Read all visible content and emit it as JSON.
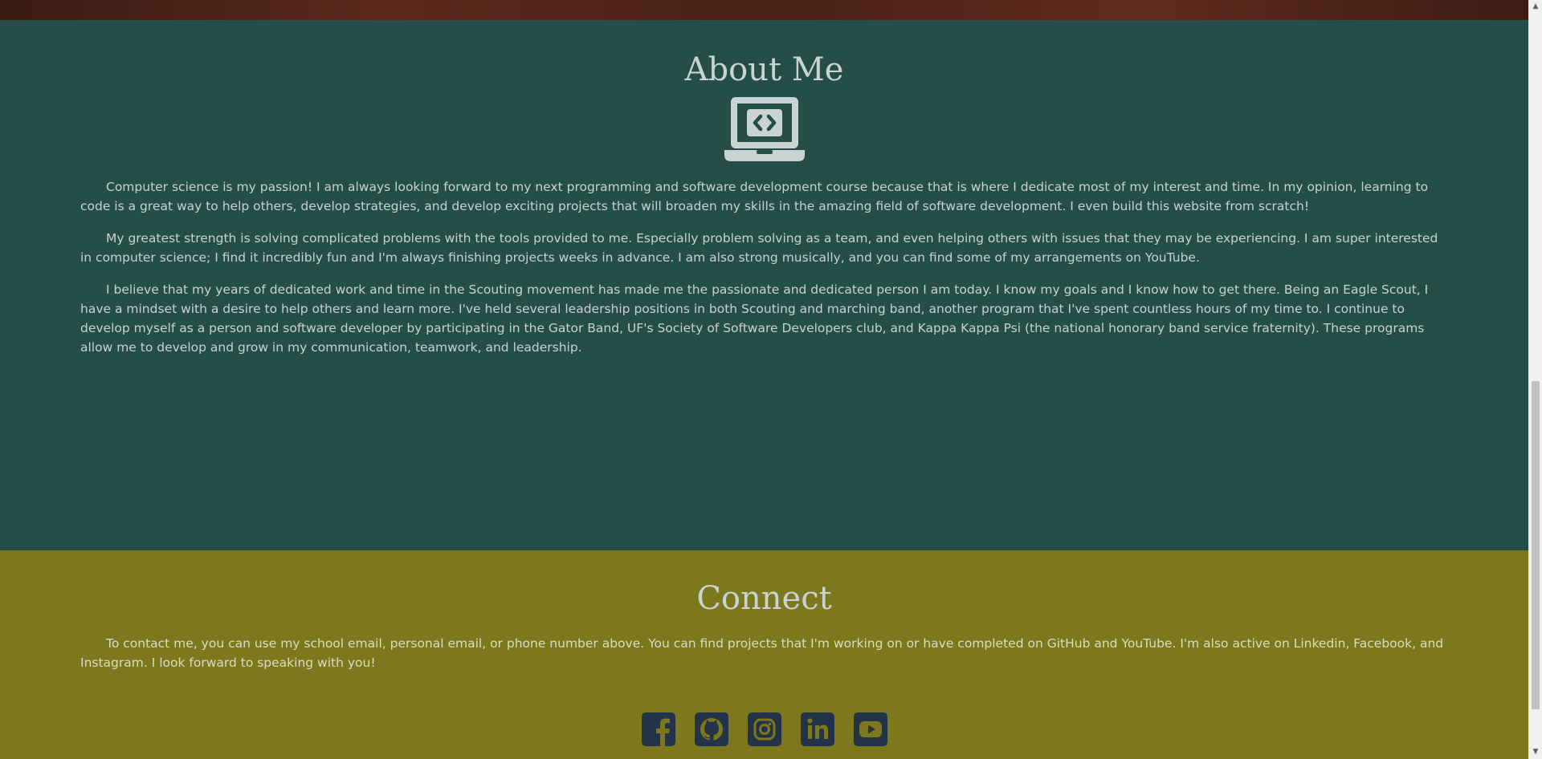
{
  "about": {
    "title": "About Me",
    "icon": "laptop-code-icon",
    "paragraphs": [
      "Computer science is my passion! I am always looking forward to my next programming and software development course because that is where I dedicate most of my interest and time. In my opinion, learning to code is a great way to help others, develop strategies, and develop exciting projects that will broaden my skills in the amazing field of software development. I even build this website from scratch!",
      "My greatest strength is solving complicated problems with the tools provided to me. Especially problem solving as a team, and even helping others with issues that they may be experiencing. I am super interested in computer science; I find it incredibly fun and I'm always finishing projects weeks in advance. I am also strong musically, and you can find some of my arrangements on YouTube.",
      "I believe that my years of dedicated work and time in the Scouting movement has made me the passionate and dedicated person I am today. I know my goals and I know how to get there. Being an Eagle Scout, I have a mindset with a desire to help others and learn more. I've held several leadership positions in both Scouting and marching band, another program that I've spent countless hours of my time to. I continue to develop myself as a person and software developer by participating in the Gator Band, UF's Society of Software Developers club, and Kappa Kappa Psi (the national honorary band service fraternity). These programs allow me to develop and grow in my communication, teamwork, and leadership."
    ]
  },
  "connect": {
    "title": "Connect",
    "paragraph": "To contact me, you can use my school email, personal email, or phone number above. You can find projects that I'm working on or have completed on GitHub and YouTube. I'm also active on Linkedin, Facebook, and Instagram. I look forward to speaking with you!",
    "social_icons": [
      "facebook-icon",
      "github-icon",
      "instagram-icon",
      "linkedin-icon",
      "youtube-icon"
    ]
  },
  "colors": {
    "about_bg": "#264e48",
    "connect_bg": "#7d771d",
    "icon_color": "#c9d4d2",
    "social_color": "#243448"
  },
  "scrollbar": {
    "up_arrow": "▲",
    "down_arrow": "▼"
  }
}
